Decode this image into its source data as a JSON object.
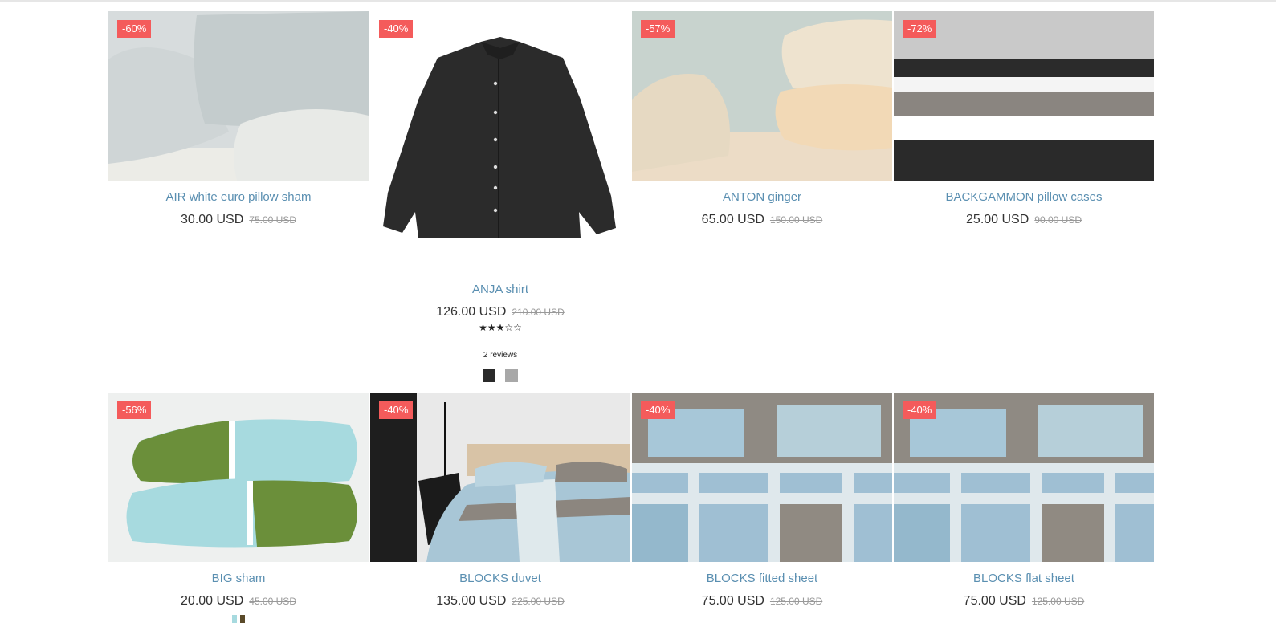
{
  "colors": {
    "badge": "#f45b5b",
    "title_link": "#5a8fb1",
    "swatch_black": "#2a2a2a",
    "swatch_grey": "#a8a8a8"
  },
  "products": [
    {
      "badge": "-60%",
      "title": "AIR white euro pillow sham",
      "price": "30.00 USD",
      "old_price": "75.00 USD"
    },
    {
      "badge": "-40%",
      "title": "ANJA shirt",
      "price": "126.00 USD",
      "old_price": "210.00 USD",
      "rating": 3,
      "stars": "★★★☆☆",
      "reviews": "2 reviews"
    },
    {
      "badge": "-57%",
      "title": "ANTON ginger",
      "price": "65.00 USD",
      "old_price": "150.00 USD"
    },
    {
      "badge": "-72%",
      "title": "BACKGAMMON pillow cases",
      "price": "25.00 USD",
      "old_price": "90.00 USD"
    },
    {
      "badge": "-56%",
      "title": "BIG sham",
      "price": "20.00 USD",
      "old_price": "45.00 USD"
    },
    {
      "badge": "-40%",
      "title": "BLOCKS duvet",
      "price": "135.00 USD",
      "old_price": "225.00 USD"
    },
    {
      "badge": "-40%",
      "title": "BLOCKS fitted sheet",
      "price": "75.00 USD",
      "old_price": "125.00 USD"
    },
    {
      "badge": "-40%",
      "title": "BLOCKS flat sheet",
      "price": "75.00 USD",
      "old_price": "125.00 USD"
    }
  ]
}
